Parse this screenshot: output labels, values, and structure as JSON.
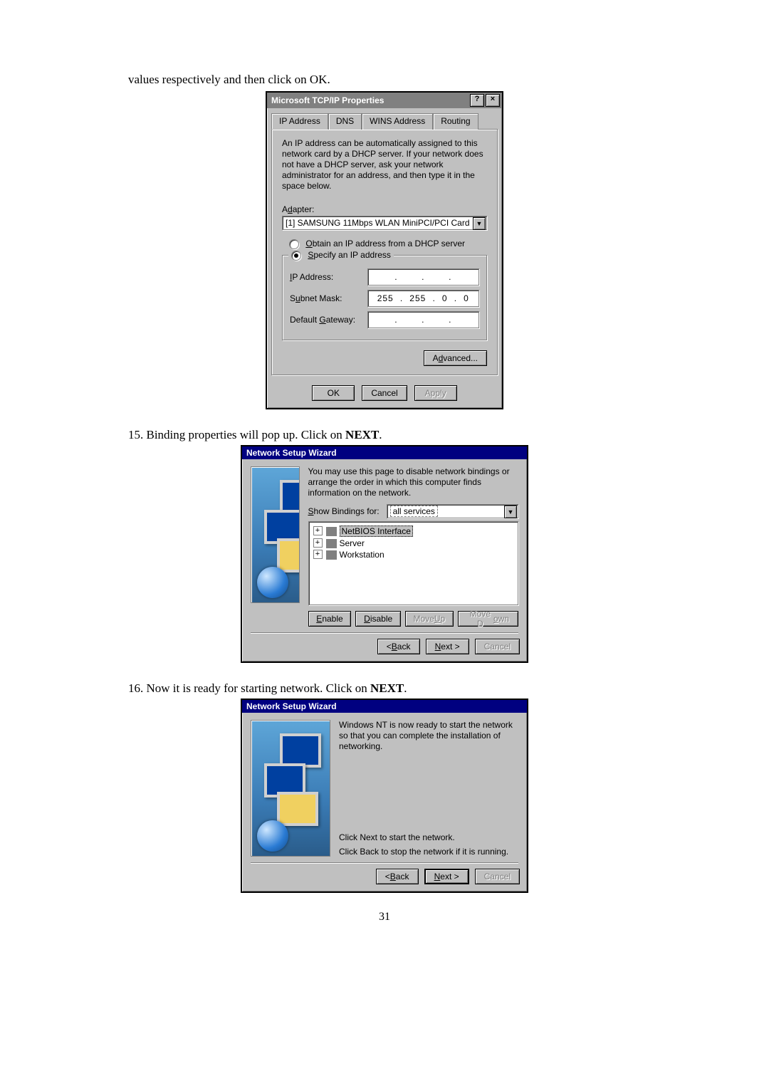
{
  "intro_text": "values respectively and then click on OK.",
  "step15_prefix": "15. ",
  "step15_text_a": "Binding properties will pop up. Click on ",
  "step15_bold": "NEXT",
  "step15_text_b": ".",
  "step16_prefix": "16. ",
  "step16_text_a": "Now it is ready for starting network. Click on ",
  "step16_bold": "NEXT",
  "step16_text_b": ".",
  "page_number": "31",
  "dlg1": {
    "title": "Microsoft TCP/IP Properties",
    "help_btn": "?",
    "close_btn": "×",
    "tabs": [
      "IP Address",
      "DNS",
      "WINS Address",
      "Routing"
    ],
    "info_text": "An IP address can be automatically assigned to this network card by a DHCP server.  If your network does not have a DHCP server, ask your network administrator for an address, and then type it in the space below.",
    "adapter_label": "Adapter:",
    "adapter_value": "[1] SAMSUNG 11Mbps WLAN MiniPCI/PCI Card",
    "radio_dhcp": "Obtain an IP address from a DHCP server",
    "radio_specify": "Specify an IP address",
    "ip_label": "IP Address:",
    "subnet_label": "Subnet Mask:",
    "gateway_label": "Default Gateway:",
    "subnet_value": [
      "255",
      "255",
      "0",
      "0"
    ],
    "advanced_btn": "Advanced...",
    "ok_btn": "OK",
    "cancel_btn": "Cancel",
    "apply_btn": "Apply"
  },
  "dlg2": {
    "title": "Network Setup Wizard",
    "intro": "You may use this page to disable network bindings or arrange the order in which this computer finds information on the network.",
    "show_label": "Show Bindings for:",
    "show_value": "all services",
    "tree_items": [
      "NetBIOS Interface",
      "Server",
      "Workstation"
    ],
    "enable_btn": "Enable",
    "disable_btn": "Disable",
    "moveup_btn": "Move Up",
    "movedown_btn": "Move Down",
    "back_btn": "< Back",
    "next_btn": "Next >",
    "cancel_btn": "Cancel"
  },
  "dlg3": {
    "title": "Network Setup Wizard",
    "line1": "Windows NT is now ready to start the network so that you can complete the installation of networking.",
    "line2": "Click Next to start the network.",
    "line3": "Click Back to stop the network if it is running.",
    "back_btn": "< Back",
    "next_btn": "Next >",
    "cancel_btn": "Cancel"
  }
}
